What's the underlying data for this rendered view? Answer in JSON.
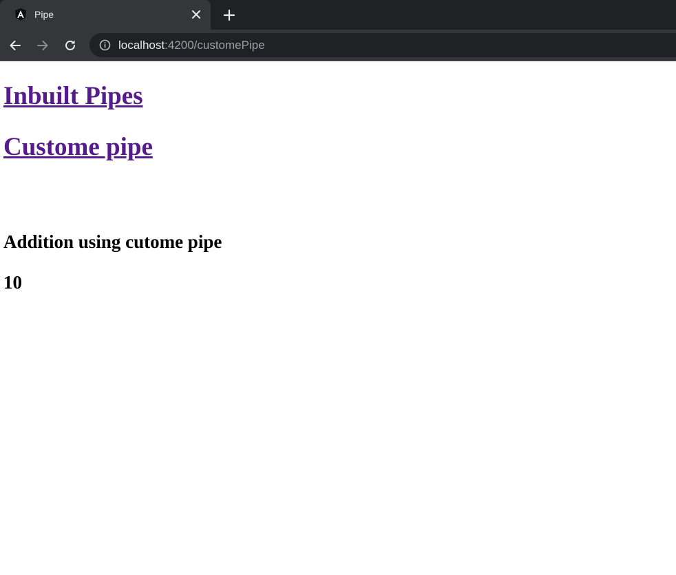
{
  "tab": {
    "title": "Pipe",
    "favicon": "angular-icon",
    "close_icon": "close-icon",
    "new_tab_icon": "plus-icon"
  },
  "toolbar": {
    "back_icon": "arrow-left-icon",
    "forward_icon": "arrow-right-icon",
    "reload_icon": "reload-icon",
    "site_info_icon": "info-icon",
    "url_host": "localhost",
    "url_rest": ":4200/customePipe"
  },
  "page": {
    "nav_links": [
      {
        "label": "Inbuilt Pipes"
      },
      {
        "label": "Custome pipe"
      }
    ],
    "addition_heading": "Addition using cutome pipe",
    "result_value": "10"
  },
  "colors": {
    "tabstrip_bg": "#202124",
    "toolbar_bg": "#35363a",
    "visited_link": "#551a8b",
    "page_bg": "#ffffff"
  }
}
